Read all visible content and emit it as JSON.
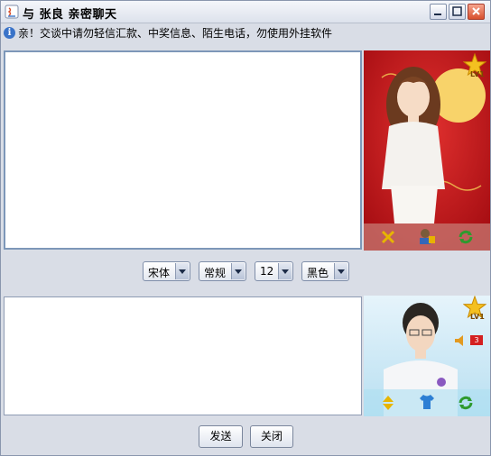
{
  "window": {
    "title": "与 张良 亲密聊天",
    "notice": "亲！交谈中请勿轻信汇款、中奖信息、陌生电话，勿使用外挂软件"
  },
  "toolbar": {
    "font": "宋体",
    "style": "常规",
    "size": "12",
    "color": "黑色"
  },
  "buttons": {
    "send": "发送",
    "close": "关闭"
  },
  "avatars": {
    "partner_level": "LV1",
    "self_level": "LV1",
    "self_volume_badge": "3"
  },
  "colors": {
    "partner_bg": "#c0141a",
    "self_bg": "#cfe9f7",
    "star": "#f4b400"
  }
}
